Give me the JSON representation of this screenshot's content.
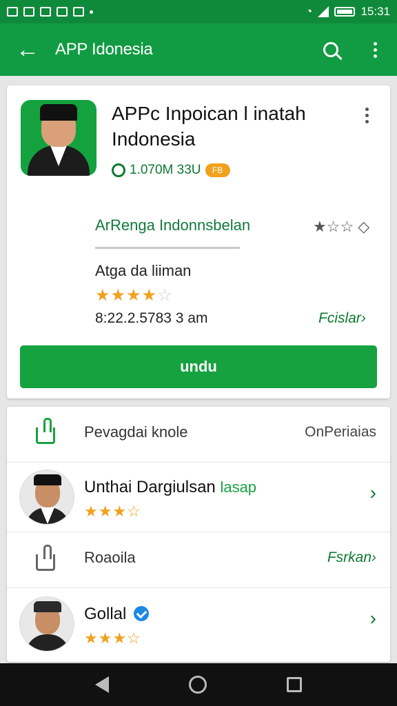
{
  "statusbar": {
    "time": "15:31"
  },
  "appbar": {
    "title": "APP Idonesia"
  },
  "app": {
    "title": "APPc Inpoican l inatah Indonesia",
    "meta_text": "1.070M 33U",
    "coin_label": "FB",
    "developer": "ArRenga Indonnsbelan",
    "developer_icons": "★☆☆ ◇",
    "rating_title": "Atga da liiman",
    "stars": "★★★★",
    "stars_dim": "☆",
    "date": "8:22.2.5783 3 am",
    "see_more": "Fcislar›",
    "install_label": "undu"
  },
  "list": {
    "row1": {
      "label": "Pevagdai knole",
      "right": "OnPeriaias"
    },
    "row2": {
      "name": "Unthai Dargiulsan",
      "badge": "lasap",
      "stars": "★★★☆"
    },
    "row3": {
      "label": "Roaoila",
      "right": "Fsrkan›"
    },
    "row4": {
      "name": "Gollal",
      "stars": "★★★☆"
    }
  },
  "colors": {
    "primary": "#119b42",
    "star": "#f0a11e",
    "verify": "#1e88e5"
  }
}
